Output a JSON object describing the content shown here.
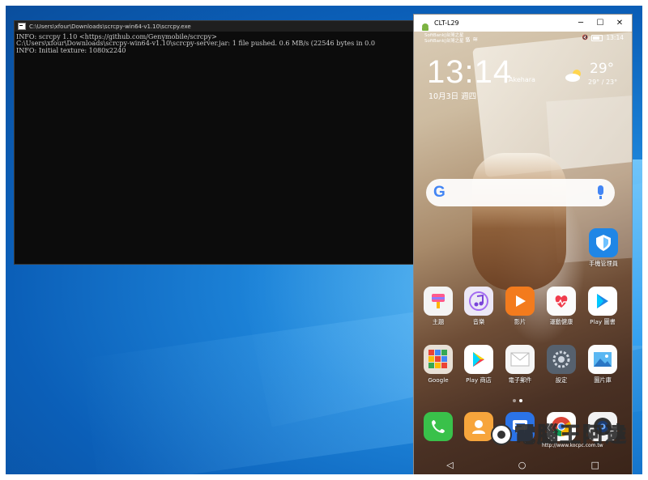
{
  "console": {
    "title": "C:\\Users\\xfour\\Downloads\\scrcpy-win64-v1.10\\scrcpy.exe",
    "lines": [
      "INFO: scrcpy 1.10 <https://github.com/Genymobile/scrcpy>",
      "C:\\Users\\xfour\\Downloads\\scrcpy-win64-v1.10\\scrcpy-server.jar: 1 file pushed. 0.6 MB/s (22546 bytes in 0.0",
      "INFO: Initial texture: 1080x2240"
    ]
  },
  "phone_window": {
    "title": "CLT-L29",
    "minimize": "─",
    "maximize": "☐",
    "close": "✕"
  },
  "status_bar": {
    "carrier1": "SoftBank|台灣之星",
    "carrier2": "SoftBank|台灣之星",
    "signal": "᯾ ≋",
    "icons": "🔇",
    "time": "13:14"
  },
  "lockscreen": {
    "clock": "13:14",
    "location": "Akehara",
    "date": "10月3日 週四",
    "temperature": "29°",
    "temp_range": "29° / 23°"
  },
  "search": {
    "logo": "G"
  },
  "apps": {
    "row0": [
      {
        "label": "手機管理員",
        "icon": "shield-icon",
        "color": "#1f86e6"
      }
    ],
    "row1": [
      {
        "label": "主題",
        "icon": "themes-icon",
        "color": "#f4f4f4"
      },
      {
        "label": "音樂",
        "icon": "music-icon",
        "color": "#ece8f6"
      },
      {
        "label": "影片",
        "icon": "video-icon",
        "color": "#f37b1d"
      },
      {
        "label": "運動健康",
        "icon": "health-icon",
        "color": "#fbfbfb"
      },
      {
        "label": "Play 圖書",
        "icon": "play-books-icon",
        "color": "#ffffff"
      }
    ],
    "row2": [
      {
        "label": "Google",
        "icon": "google-folder-icon",
        "color": "#e8e0d6"
      },
      {
        "label": "Play 商店",
        "icon": "play-store-icon",
        "color": "#ffffff"
      },
      {
        "label": "電子郵件",
        "icon": "email-icon",
        "color": "#f6f6f6"
      },
      {
        "label": "設定",
        "icon": "settings-icon",
        "color": "#56616e"
      },
      {
        "label": "圖片庫",
        "icon": "gallery-icon",
        "color": "#fdfdfd"
      }
    ],
    "dock": [
      {
        "label": "",
        "icon": "phone-icon",
        "color": "#39c14a"
      },
      {
        "label": "",
        "icon": "contacts-icon",
        "color": "#f7a53c"
      },
      {
        "label": "",
        "icon": "messages-icon",
        "color": "#2b73e6"
      },
      {
        "label": "",
        "icon": "chrome-icon",
        "color": "#ffffff"
      },
      {
        "label": "",
        "icon": "camera-icon",
        "color": "#f2f2f2"
      }
    ]
  },
  "navbar": {
    "back": "◁",
    "home": "○",
    "recent": "□"
  },
  "watermark": {
    "text": "電腦王阿達",
    "url": "http://www.kocpc.com.tw"
  }
}
